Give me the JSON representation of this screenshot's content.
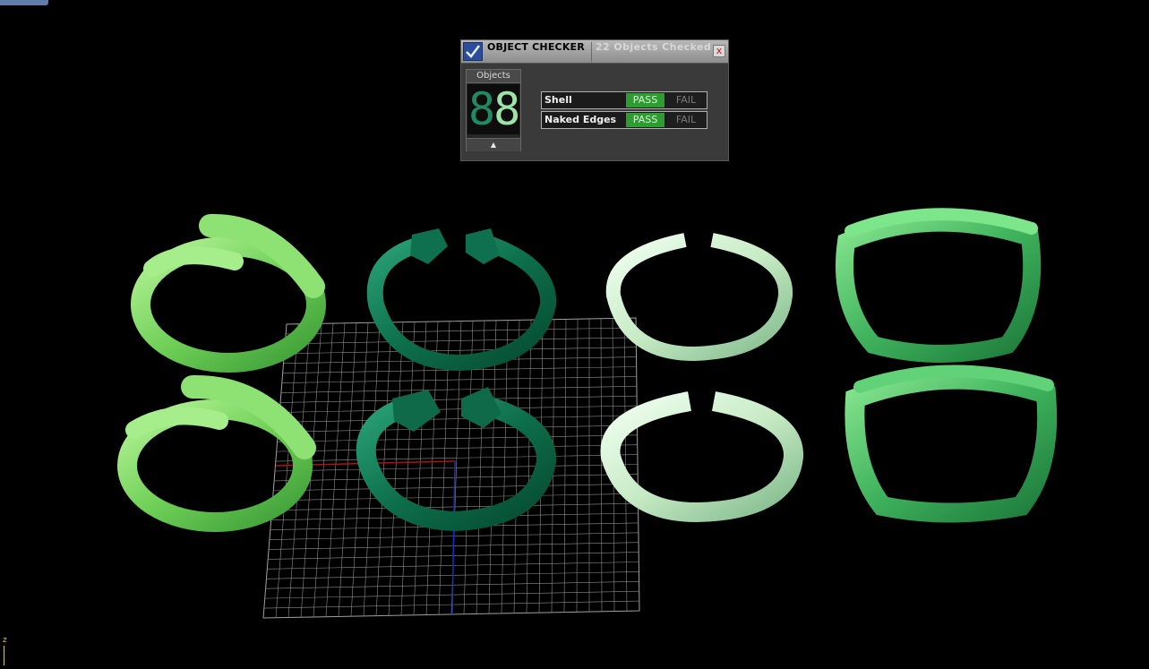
{
  "panel": {
    "title": "OBJECT CHECKER",
    "summary": "22  Objects Checked",
    "close_symbol": "x",
    "objects_label": "Objects",
    "counter_digits": "8",
    "counter_digits_dim": "8",
    "scroll_symbol": "▲",
    "checks": [
      {
        "name": "Shell",
        "pass": "PASS",
        "fail": "FAIL",
        "status": "pass"
      },
      {
        "name": "Naked Edges",
        "pass": "PASS",
        "fail": "FAIL",
        "status": "pass"
      }
    ]
  },
  "viewport": {
    "axis_label": "z",
    "colors": {
      "light_green": "#7fd66a",
      "dark_green": "#0f7a52",
      "pale_green": "#c9ecca",
      "mid_green": "#45c06a",
      "grid": "#9a9a9a",
      "x_axis": "#b01010",
      "y_axis": "#1030c0"
    }
  }
}
